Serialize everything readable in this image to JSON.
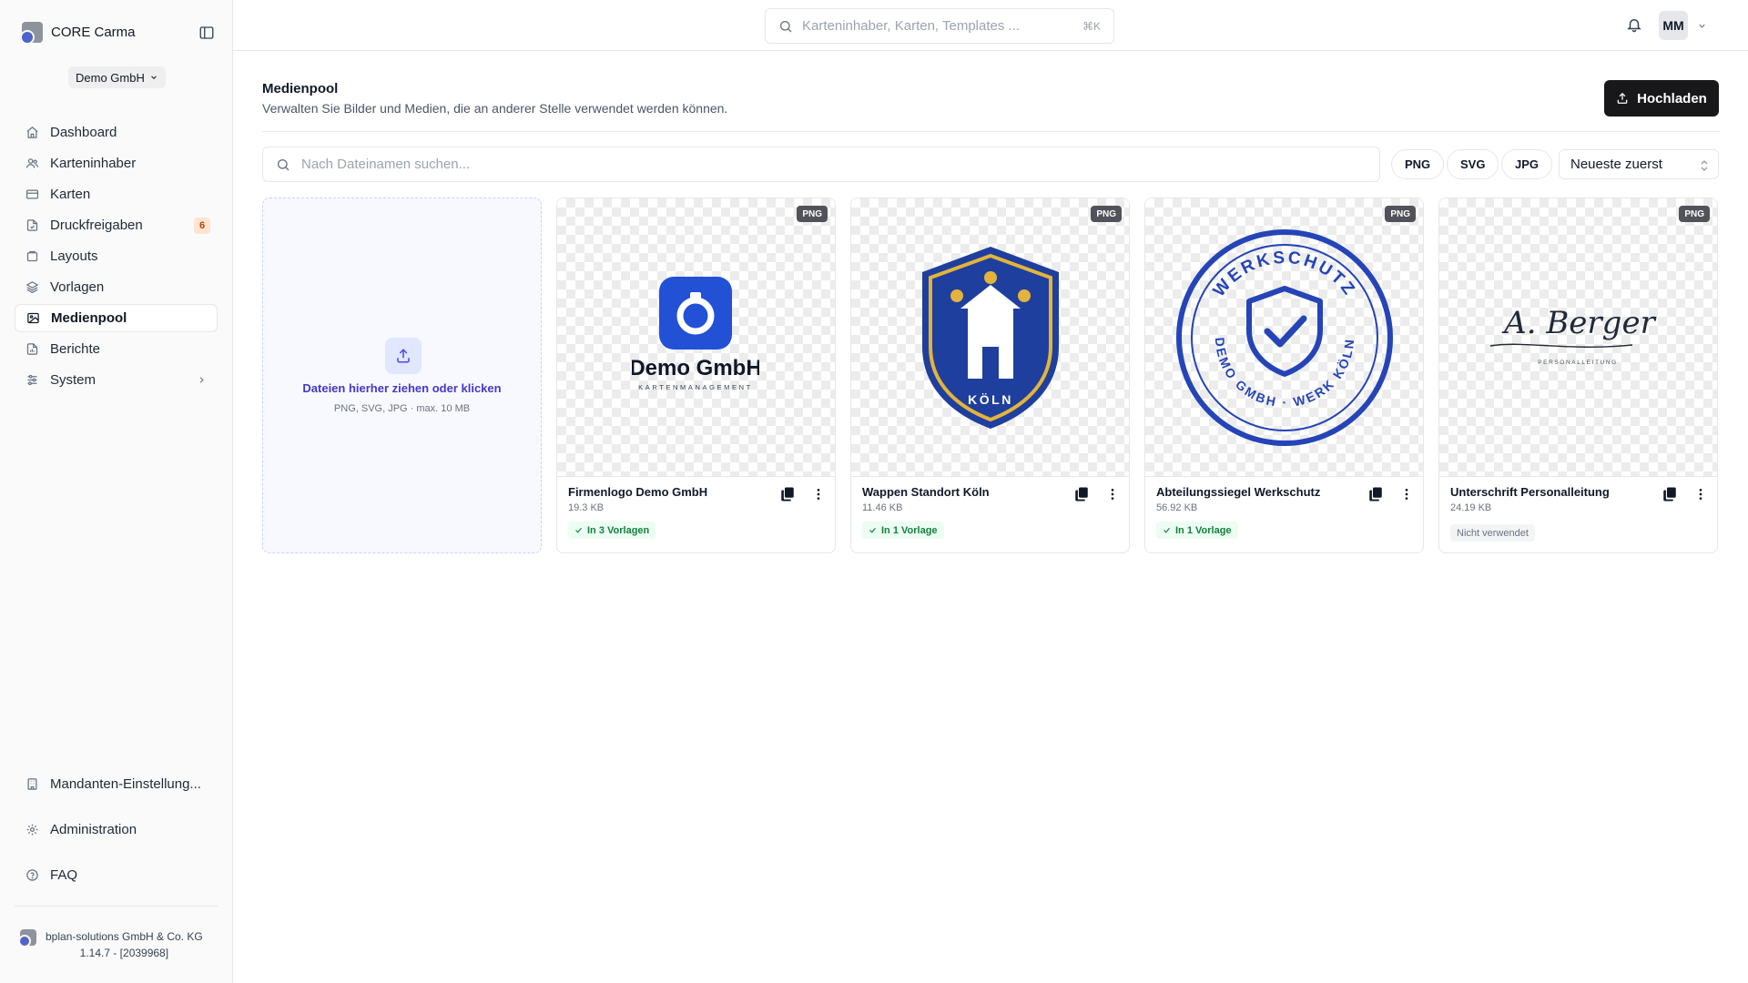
{
  "app": {
    "name": "CORE Carma",
    "tenant": "Demo GmbH"
  },
  "sidebar": {
    "items": [
      {
        "label": "Dashboard",
        "icon": "home-icon"
      },
      {
        "label": "Karteninhaber",
        "icon": "users-icon"
      },
      {
        "label": "Karten",
        "icon": "credit-card-icon"
      },
      {
        "label": "Druckfreigaben",
        "icon": "file-check-icon",
        "badge": "6"
      },
      {
        "label": "Layouts",
        "icon": "layout-icon"
      },
      {
        "label": "Vorlagen",
        "icon": "layers-icon"
      },
      {
        "label": "Medienpool",
        "icon": "image-icon",
        "active": true
      },
      {
        "label": "Berichte",
        "icon": "report-icon"
      },
      {
        "label": "System",
        "icon": "sliders-icon"
      }
    ],
    "bottom_items": [
      {
        "label": "Mandanten-Einstellung...",
        "icon": "building-icon"
      },
      {
        "label": "Administration",
        "icon": "gear-icon"
      },
      {
        "label": "FAQ",
        "icon": "help-circle-icon"
      }
    ],
    "footer": {
      "company": "bplan-solutions GmbH & Co. KG",
      "version": "1.14.7 - [2039968]"
    }
  },
  "header": {
    "search_placeholder": "Karteninhaber, Karten, Templates ...",
    "search_shortcut": "⌘K",
    "user_initials": "MM"
  },
  "page": {
    "title": "Medienpool",
    "subtitle": "Verwalten Sie Bilder und Medien, die an anderer Stelle verwendet werden können.",
    "upload_label": "Hochladen",
    "file_search_placeholder": "Nach Dateinamen suchen...",
    "filters": [
      "PNG",
      "SVG",
      "JPG"
    ],
    "sort_value": "Neueste zuerst",
    "dropzone": {
      "title": "Dateien hierher ziehen oder klicken",
      "hint": "PNG, SVG, JPG · max. 10 MB"
    }
  },
  "media": [
    {
      "name": "Firmenlogo Demo GmbH",
      "size": "19.3 KB",
      "type": "PNG",
      "usage": "In 3 Vorlagen",
      "used": true,
      "art_text": {
        "title": "Demo GmbH",
        "subtitle": "KARTENMANAGEMENT"
      }
    },
    {
      "name": "Wappen Standort Köln",
      "size": "11.46 KB",
      "type": "PNG",
      "usage": "In 1 Vorlage",
      "used": true,
      "art_text": {
        "title": "KÖLN"
      }
    },
    {
      "name": "Abteilungssiegel Werkschutz",
      "size": "56.92 KB",
      "type": "PNG",
      "usage": "In 1 Vorlage",
      "used": true,
      "art_text": {
        "top": "WERKSCHUTZ",
        "bottom": "DEMO GMBH · WERK KÖLN"
      }
    },
    {
      "name": "Unterschrift Personalleitung",
      "size": "24.19 KB",
      "type": "PNG",
      "usage": "Nicht verwendet",
      "used": false,
      "art_text": {
        "signature": "A. Berger",
        "subtitle": "PERSONALLEITUNG"
      }
    }
  ],
  "colors": {
    "accent": "#18181b",
    "brand_blue": "#2251d6",
    "crest_blue": "#1f3f9e",
    "crest_gold": "#e3b43b",
    "badge_orange": "#c2410c",
    "usage_green": "#15803d"
  }
}
